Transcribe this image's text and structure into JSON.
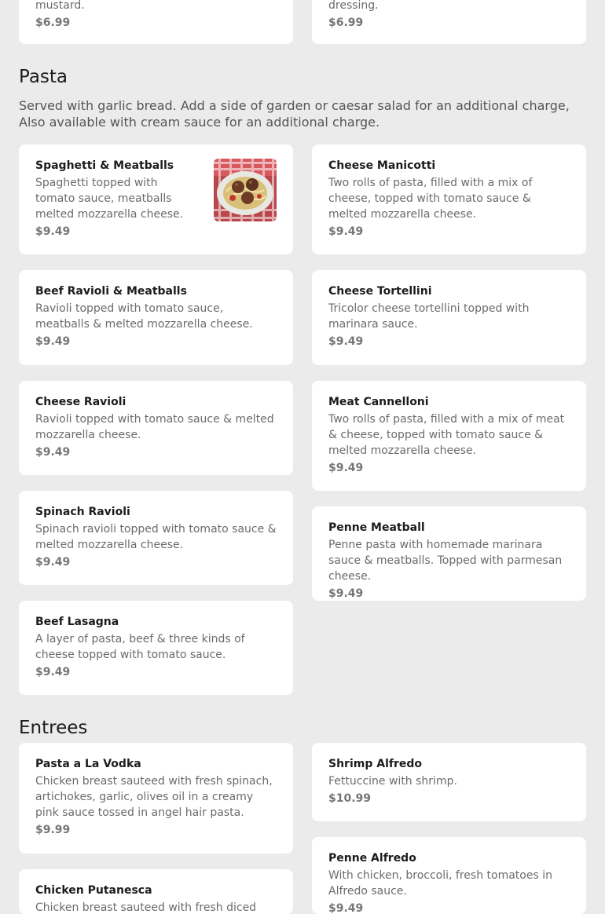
{
  "top": {
    "left": {
      "desc_tail": "mustard.",
      "price": "$6.99"
    },
    "right": {
      "desc_tail": "dressing.",
      "price": "$6.99"
    }
  },
  "pasta": {
    "title": "Pasta",
    "description": "Served with garlic bread. Add a side of garden or caesar salad for an additional charge, Also available with cream sauce for an additional charge.",
    "items": [
      {
        "name": "Spaghetti & Meatballs",
        "desc": "Spaghetti topped with tomato sauce, meatballs melted mozzarella cheese.",
        "price": "$9.49"
      },
      {
        "name": "Cheese Manicotti",
        "desc": "Two rolls of pasta, filled with a mix of cheese, topped with tomato sauce & melted mozzarella cheese.",
        "price": "$9.49"
      },
      {
        "name": "Beef Ravioli & Meatballs",
        "desc": "Ravioli topped with tomato sauce, meatballs & melted mozzarella cheese.",
        "price": "$9.49"
      },
      {
        "name": "Cheese Tortellini",
        "desc": "Tricolor cheese tortellini topped with marinara sauce.",
        "price": "$9.49"
      },
      {
        "name": "Cheese Ravioli",
        "desc": "Ravioli topped with tomato sauce & melted mozzarella cheese.",
        "price": "$9.49"
      },
      {
        "name": "Meat Cannelloni",
        "desc": "Two rolls of pasta, filled with a mix of meat & cheese, topped with tomato sauce & melted mozzarella cheese.",
        "price": "$9.49"
      },
      {
        "name": "Spinach Ravioli",
        "desc": "Spinach ravioli topped with tomato sauce & melted mozzarella cheese.",
        "price": "$9.49"
      },
      {
        "name": "Penne Meatball",
        "desc": "Penne pasta with homemade marinara sauce & meatballs. Topped with parmesan cheese.",
        "price": "$9.49"
      },
      {
        "name": "Beef Lasagna",
        "desc": "A layer of pasta, beef & three kinds of cheese topped with tomato sauce.",
        "price": "$9.49"
      }
    ]
  },
  "entrees": {
    "title": "Entrees",
    "items": [
      {
        "name": "Pasta a La Vodka",
        "desc": "Chicken breast sauteed with fresh spinach, artichokes, garlic, olives oil in a creamy pink sauce tossed in angel hair pasta.",
        "price": "$9.99"
      },
      {
        "name": "Shrimp Alfredo",
        "desc": "Fettuccine with shrimp.",
        "price": "$10.99"
      },
      {
        "name": "Penne Alfredo",
        "desc": "With chicken, broccoli, fresh tomatoes in Alfredo sauce.",
        "price": "$9.49"
      },
      {
        "name": "Chicken Putanesca",
        "desc": "Chicken breast sauteed with fresh diced",
        "price": ""
      }
    ]
  }
}
